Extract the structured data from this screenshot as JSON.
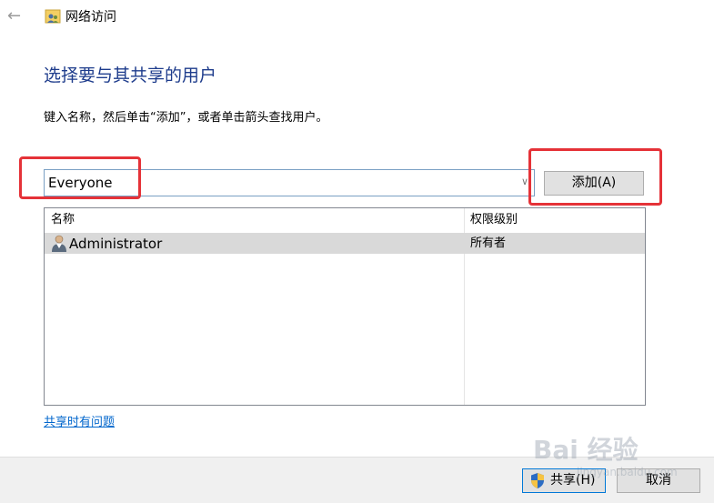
{
  "window": {
    "title": "网络访问"
  },
  "main": {
    "heading": "选择要与其共享的用户",
    "instruction": "键入名称，然后单击“添加”，或者单击箭头查找用户。",
    "name_input_value": "Everyone",
    "add_button_label": "添加(A)"
  },
  "user_list": {
    "columns": [
      "名称",
      "权限级别"
    ],
    "rows": [
      {
        "name": "Administrator",
        "permission": "所有者",
        "icon": "user-icon"
      }
    ]
  },
  "help_link": "共享时有问题",
  "footer": {
    "share_button_label": "共享(H)",
    "cancel_button_label": "取消"
  },
  "watermark": {
    "main": "Bai 经验",
    "sub": "jingyan.baidu.com"
  },
  "colors": {
    "heading": "#1e3c8c",
    "link": "#0066cc",
    "highlight": "#e53238",
    "selected_row": "#d9d9d9",
    "footer_bg": "#f0f0f0"
  }
}
